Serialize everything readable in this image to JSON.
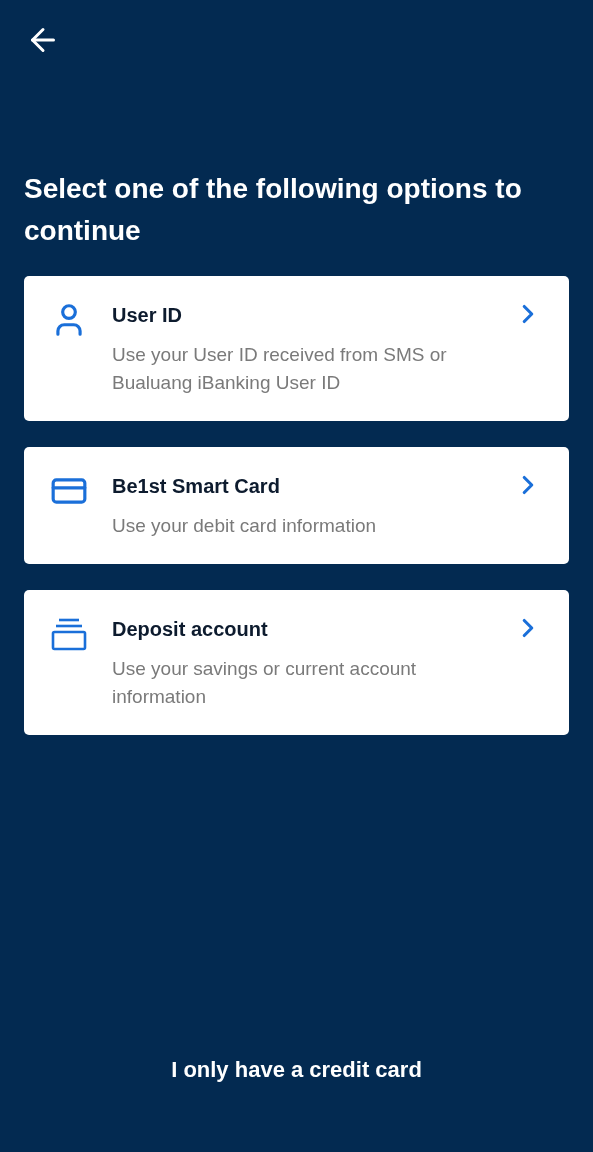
{
  "title": "Select one of the following options to continue",
  "options": [
    {
      "kind": "user",
      "title": "User ID",
      "description": "Use your User ID received from SMS or Bualuang iBanking User ID"
    },
    {
      "kind": "card",
      "title": "Be1st Smart Card",
      "description": "Use your debit card information"
    },
    {
      "kind": "account",
      "title": "Deposit account",
      "description": "Use your savings or current account information"
    }
  ],
  "footer_link": "I only have a credit card"
}
